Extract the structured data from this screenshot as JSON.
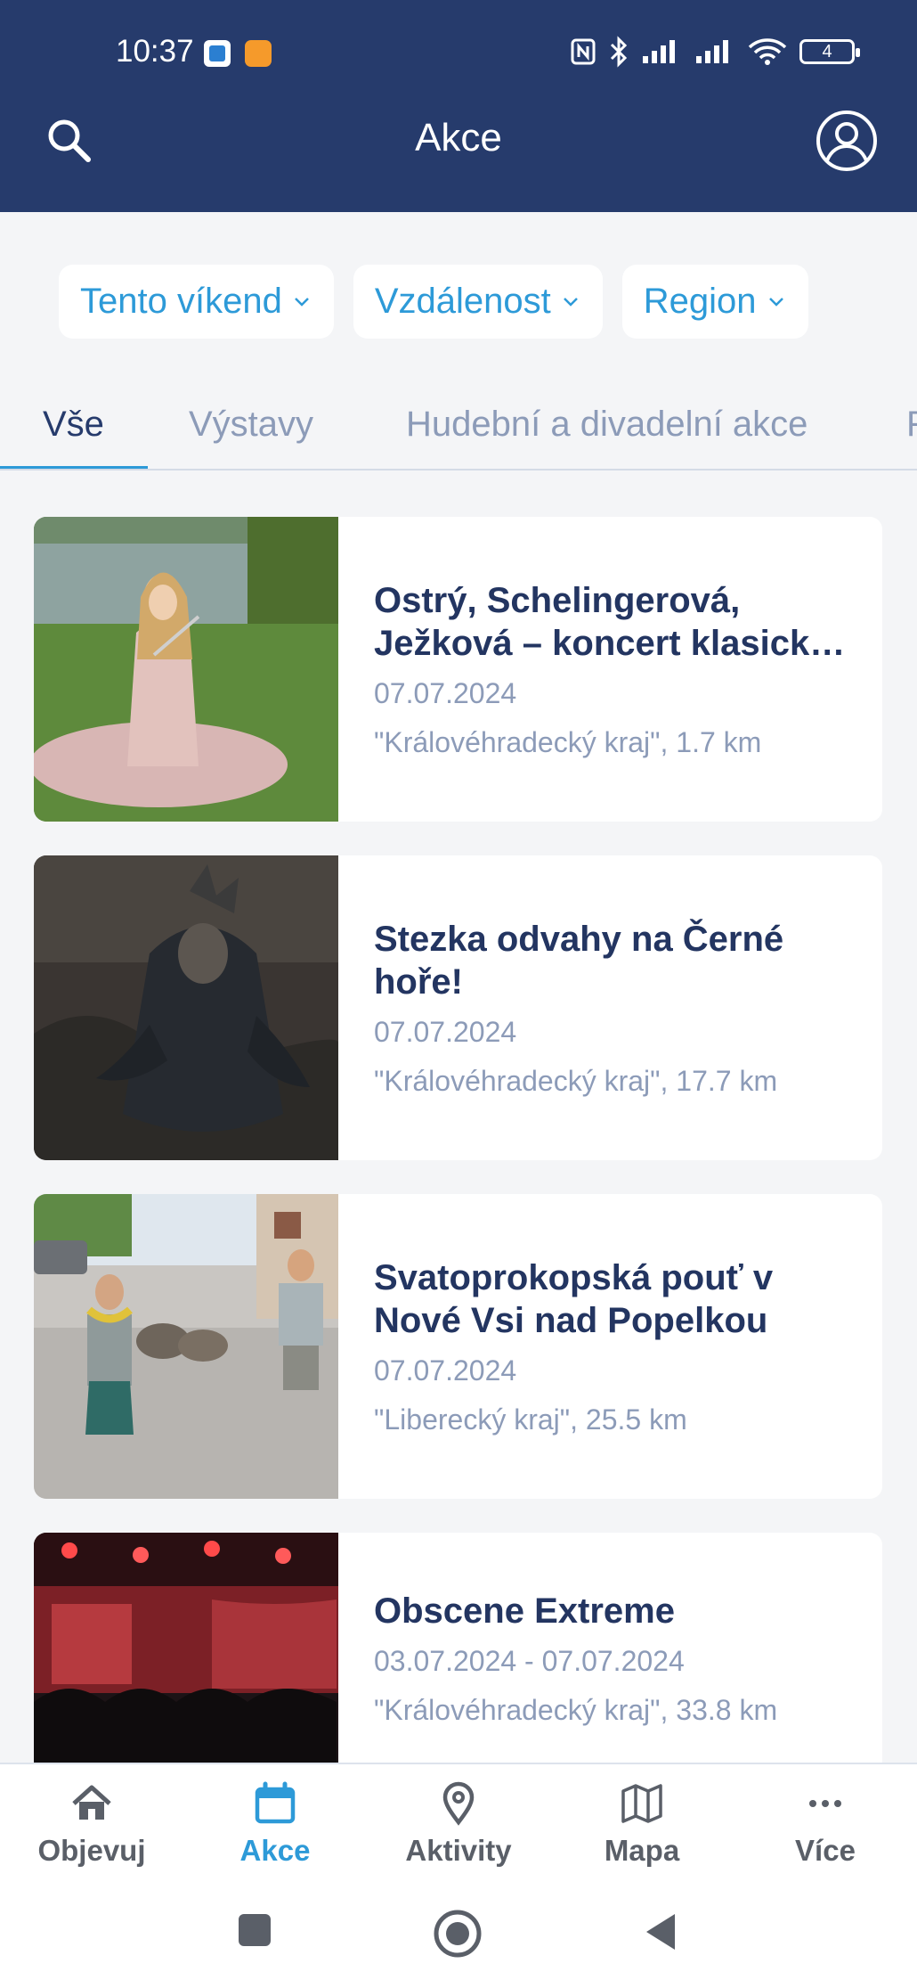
{
  "status_bar": {
    "time": "10:37",
    "battery": "4"
  },
  "header": {
    "title": "Akce"
  },
  "filters": [
    {
      "label": "Tento víkend"
    },
    {
      "label": "Vzdálenost"
    },
    {
      "label": "Region"
    }
  ],
  "tabs": [
    {
      "label": "Vše",
      "active": true
    },
    {
      "label": "Výstavy",
      "active": false
    },
    {
      "label": "Hudební a divadelní akce",
      "active": false
    },
    {
      "label": "F",
      "active": false
    }
  ],
  "events": [
    {
      "title": "Ostrý, Schelingerová, Ježková – koncert klasick…",
      "date": "07.07.2024",
      "location": "\"Královéhradecký kraj\", 1.7 km",
      "image": "flutist-on-lake-shore"
    },
    {
      "title": "Stezka odvahy na Černé hoře!",
      "date": "07.07.2024",
      "location": "\"Královéhradecký kraj\", 17.7 km",
      "image": "furry-creature-costume"
    },
    {
      "title": "Svatoprokopská pouť v Nové Vsi nad Popelkou",
      "date": "07.07.2024",
      "location": "\"Liberecký kraj\", 25.5 km",
      "image": "people-walking-with-donkeys"
    },
    {
      "title": "Obscene Extreme",
      "date": "03.07.2024 - 07.07.2024",
      "location": "\"Královéhradecký kraj\", 33.8 km",
      "image": "concert-stage-crowd"
    }
  ],
  "bottom_nav": [
    {
      "label": "Objevuj",
      "icon": "home-icon",
      "active": false
    },
    {
      "label": "Akce",
      "icon": "calendar-icon",
      "active": true
    },
    {
      "label": "Aktivity",
      "icon": "location-pin-icon",
      "active": false
    },
    {
      "label": "Mapa",
      "icon": "map-icon",
      "active": false
    },
    {
      "label": "Více",
      "icon": "more-dots-icon",
      "active": false
    }
  ],
  "colors": {
    "header_bg": "#263b6c",
    "accent": "#2d9ad8",
    "title_text": "#233561",
    "muted_text": "#8c9bb8"
  }
}
